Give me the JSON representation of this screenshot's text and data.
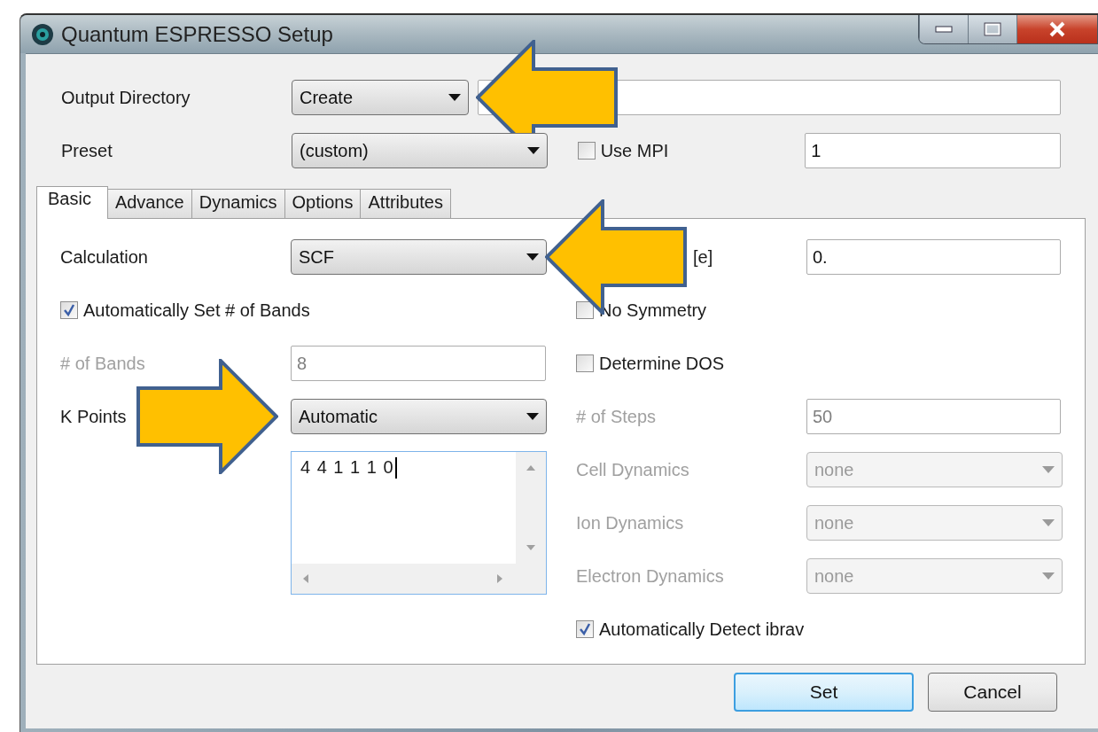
{
  "window": {
    "title": "Quantum ESPRESSO Setup"
  },
  "output_directory": {
    "label": "Output Directory",
    "mode": "Create",
    "arrow_left": true
  },
  "preset": {
    "label": "Preset",
    "value": "(custom)"
  },
  "use_mpi": {
    "label": "Use MPI",
    "checked": false,
    "value": "1"
  },
  "tabs": [
    {
      "label": "Basic",
      "selected": true
    },
    {
      "label": "Advance",
      "selected": false
    },
    {
      "label": "Dynamics",
      "selected": false
    },
    {
      "label": "Options",
      "selected": false
    },
    {
      "label": "Attributes",
      "selected": false
    }
  ],
  "basic": {
    "left": [
      {
        "kind": "dropdown",
        "label": "Calculation",
        "value": "SCF",
        "disabled": false,
        "arrow_left": true
      },
      {
        "kind": "checkbox",
        "label": "Automatically Set # of Bands",
        "checked": true
      },
      {
        "kind": "field",
        "label": "# of Bands",
        "value": "8",
        "disabled": true
      },
      {
        "kind": "dropdown",
        "label": "K Points",
        "value": "Automatic",
        "disabled": false,
        "arrow_right": true
      },
      {
        "kind": "textarea",
        "value": "4 4 1 1 1 0",
        "focused": true
      }
    ],
    "right": [
      {
        "kind": "field",
        "label": "[e]",
        "value": "0.",
        "disabled": false,
        "covered": true
      },
      {
        "kind": "checkbox",
        "label": "No Symmetry",
        "checked": false
      },
      {
        "kind": "checkbox",
        "label": "Determine DOS",
        "checked": false
      },
      {
        "kind": "field",
        "label": "# of Steps",
        "value": "50",
        "disabled": true
      },
      {
        "kind": "dropdown",
        "label": "Cell Dynamics",
        "value": "none",
        "disabled": true
      },
      {
        "kind": "dropdown",
        "label": "Ion Dynamics",
        "value": "none",
        "disabled": true
      },
      {
        "kind": "dropdown",
        "label": "Electron Dynamics",
        "value": "none",
        "disabled": true
      },
      {
        "kind": "checkbox",
        "label": "Automatically Detect ibrav",
        "checked": true
      }
    ]
  },
  "buttons": [
    {
      "label": "Set",
      "default": true
    },
    {
      "label": "Cancel",
      "default": false
    }
  ]
}
